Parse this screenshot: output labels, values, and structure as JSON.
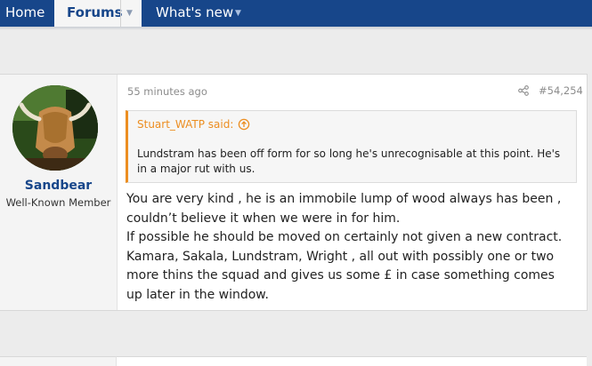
{
  "nav": {
    "home": "Home",
    "forums": "Forums",
    "whats_new": "What's new"
  },
  "post": {
    "user": {
      "name": "Sandbear",
      "title": "Well-Known Member"
    },
    "date": "55 minutes ago",
    "number": "#54,254",
    "quote": {
      "author": "Stuart_WATP said:",
      "text": "Lundstram has been off form for so long he's unrecognisable at this point. He's in a major rut with us."
    },
    "message": {
      "line1": "You are very kind , he is an immobile lump of wood always has been , couldn’t believe it when we were in for him.",
      "line2": "If possible he should be moved on certainly not given a new contract. Kamara, Sakala, Lundstram, Wright , all out with possibly one or two more thins the squad and gives us some £ in case something comes up later in the window."
    }
  },
  "colors": {
    "nav_bg": "#17468a",
    "accent_orange": "#ec8e21",
    "username": "#17468a"
  }
}
